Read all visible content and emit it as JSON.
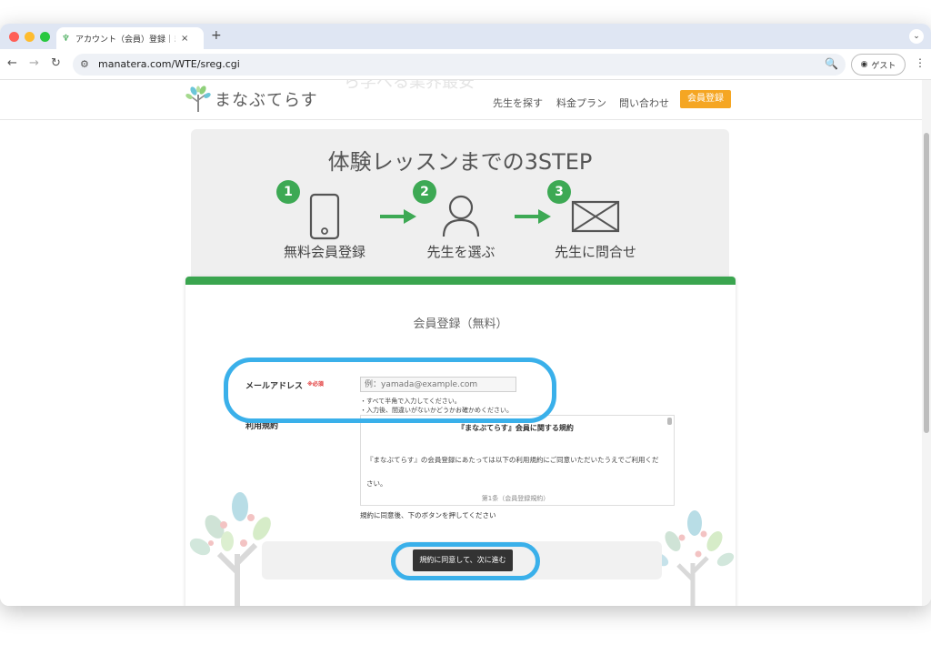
{
  "browser": {
    "tab_title": "アカウント（会員）登録｜まなぶてらす",
    "url": "manatera.com/WTE/sreg.cgi",
    "guest_label": "ゲスト",
    "new_tab": "+",
    "tab_close": "×"
  },
  "site": {
    "logo_text": "まなぶてらす",
    "ghost_heading": "ら学べる業界最安",
    "nav": [
      "先生を探す",
      "料金プラン",
      "問い合わせ"
    ],
    "register_button": "会員登録"
  },
  "steps": {
    "title": "体験レッスンまでの3STEP",
    "items": [
      {
        "number": "1",
        "label": "無料会員登録",
        "icon": "smartphone-icon"
      },
      {
        "number": "2",
        "label": "先生を選ぶ",
        "icon": "person-icon"
      },
      {
        "number": "3",
        "label": "先生に問合せ",
        "icon": "envelope-icon"
      }
    ]
  },
  "form": {
    "title": "会員登録（無料）",
    "email_label": "メールアドレス",
    "required_badge": "※必須",
    "email_placeholder": "例：yamada@example.com",
    "notes": [
      "・すべて半角で入力してください。",
      "・入力後、間違いがないかどうかお確かめください。"
    ],
    "terms_label": "利用規約",
    "terms_title": "『まなぶてらす』会員に関する規約",
    "terms_body": "『まなぶてらす』の会員登録にあたっては以下の利用規約にご同意いただいたうえでご利用ください。",
    "terms_article": "第1条（会員登録規約）",
    "agree_note": "規約に同意後、下のボタンを押してください",
    "submit_label": "規約に同意して、次に進む"
  },
  "colors": {
    "accent_green": "#3aa54f",
    "register_orange": "#f5a623",
    "highlight_blue": "#3ab0ea"
  }
}
